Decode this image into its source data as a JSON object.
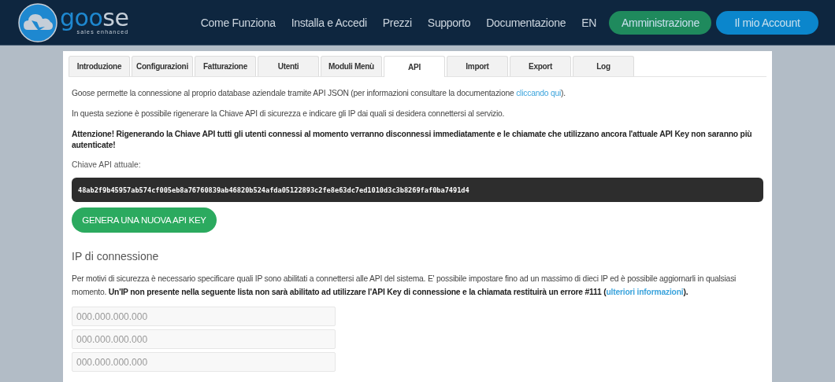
{
  "header": {
    "logo": {
      "name_parts": [
        {
          "text": "goo",
          "color": "#1e88d0"
        },
        {
          "text": "se",
          "color": "#c5ced8"
        }
      ],
      "tagline": "sales enhanced"
    },
    "nav": [
      {
        "label": "Come Funziona"
      },
      {
        "label": "Installa e Accedi"
      },
      {
        "label": "Prezzi"
      },
      {
        "label": "Supporto"
      },
      {
        "label": "Documentazione"
      },
      {
        "label": "EN"
      }
    ],
    "buttons": [
      {
        "label": "Amministrazione",
        "kind": "green"
      },
      {
        "label": "Il mio Account",
        "kind": "blue"
      }
    ]
  },
  "tabs": [
    {
      "label": "Introduzione",
      "selected": false
    },
    {
      "label": "Configurazioni",
      "selected": false
    },
    {
      "label": "Fatturazione",
      "selected": false
    },
    {
      "label": "Utenti",
      "selected": false
    },
    {
      "label": "Moduli Menù",
      "selected": false
    },
    {
      "label": "API",
      "selected": true
    },
    {
      "label": "Import",
      "selected": false
    },
    {
      "label": "Export",
      "selected": false
    },
    {
      "label": "Log",
      "selected": false
    }
  ],
  "intro": [
    {
      "segments": [
        {
          "text": "Goose permette la connessione al proprio database aziendale tramite API JSON (per informazioni consultare la documentazione "
        },
        {
          "text": "cliccando qui",
          "kind": "link"
        },
        {
          "text": ")."
        }
      ]
    },
    {
      "segments": [
        {
          "text": "In questa sezione è possibile rigenerare la Chiave API di sicurezza e indicare gli IP dai quali si desidera connettersi al servizio."
        }
      ]
    },
    {
      "segments": [
        {
          "text": "Attenzione! Rigenerando la Chiave API tutti gli utenti connessi al momento verranno disconnessi immediatamente e le chiamate che utilizzano ancora l'attuale API Key non saranno più autenticate!",
          "kind": "bold"
        }
      ]
    }
  ],
  "api_key": {
    "label": "Chiave API attuale:",
    "value": "48ab2f9b45957ab574cf005eb8a76760839ab46820b524afda05122893c2fe8e63dc7ed1010d3c3b8269faf0ba7491d4"
  },
  "regenerate_button": "GENERA UNA NUOVA API KEY",
  "ip_section": {
    "title": "IP di connessione",
    "description": [
      {
        "text": "Per motivi di sicurezza è necessario specificare quali IP sono abilitati a connettersi alle API del sistema. E' possibile impostare fino ad un massimo di dieci IP ed è possibile aggiornarli in qualsiasi momento. "
      },
      {
        "text": "Un'IP non presente nella seguente lista non sarà abilitato ad utilizzare l'API Key di connessione e la chiamata restituirà un errore #111 (",
        "kind": "bold"
      },
      {
        "text": "ulteriori informazioni",
        "kind": "link"
      },
      {
        "text": ").",
        "kind": "bold"
      }
    ],
    "fields": [
      {
        "placeholder": "000.000.000.000"
      },
      {
        "placeholder": "000.000.000.000"
      },
      {
        "placeholder": "000.000.000.000"
      }
    ]
  }
}
